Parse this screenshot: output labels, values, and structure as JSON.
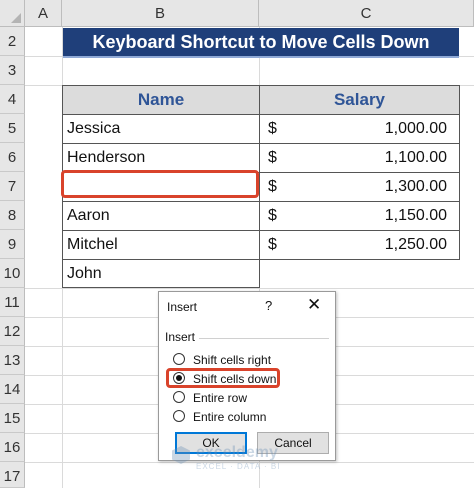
{
  "columns": [
    "A",
    "B",
    "C"
  ],
  "rows": [
    "2",
    "3",
    "4",
    "5",
    "6",
    "7",
    "8",
    "9",
    "10",
    "11",
    "12",
    "13",
    "14",
    "15",
    "16",
    "17"
  ],
  "title": "Keyboard Shortcut to Move Cells Down",
  "table": {
    "headers": {
      "name": "Name",
      "salary": "Salary"
    },
    "rows": [
      {
        "name": "Jessica",
        "currency": "$",
        "amount": "1,000.00"
      },
      {
        "name": "Henderson",
        "currency": "$",
        "amount": "1,100.00"
      },
      {
        "name": "",
        "currency": "$",
        "amount": "1,300.00"
      },
      {
        "name": "Aaron",
        "currency": "$",
        "amount": "1,150.00"
      },
      {
        "name": "Mitchel",
        "currency": "$",
        "amount": "1,250.00"
      },
      {
        "name": "John",
        "currency": "",
        "amount": ""
      }
    ]
  },
  "dialog": {
    "title": "Insert",
    "help": "?",
    "close": "✕",
    "group_label": "Insert",
    "options": [
      {
        "label": "Shift cells right",
        "selected": false
      },
      {
        "label": "Shift cells down",
        "selected": true
      },
      {
        "label": "Entire row",
        "selected": false
      },
      {
        "label": "Entire column",
        "selected": false
      }
    ],
    "ok_label": "OK",
    "cancel_label": "Cancel"
  },
  "watermark": {
    "name": "exceldemy",
    "tagline": "EXCEL · DATA · BI"
  },
  "colors": {
    "title_bg": "#1f3f7a",
    "header_text": "#2f5597",
    "highlight": "#d9432b",
    "default_button": "#0078d7"
  }
}
